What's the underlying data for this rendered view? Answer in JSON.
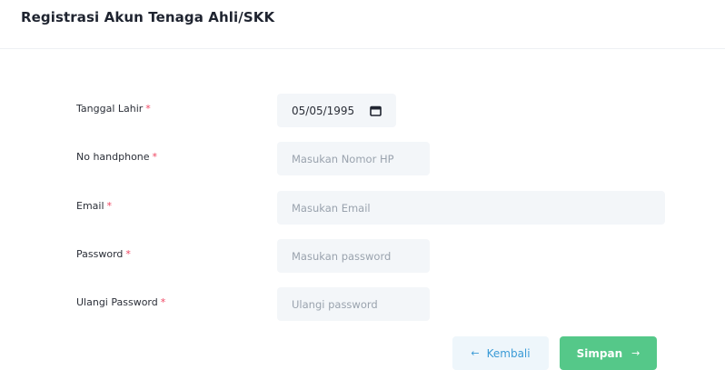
{
  "page": {
    "title": "Registrasi Akun Tenaga Ahli/SKK"
  },
  "form": {
    "required_mark": "*",
    "birth_date": {
      "label": "Tanggal Lahir",
      "value": "05/05/1995"
    },
    "phone": {
      "label": "No handphone",
      "placeholder": "Masukan Nomor HP"
    },
    "email": {
      "label": "Email",
      "placeholder": "Masukan Email"
    },
    "password": {
      "label": "Password",
      "placeholder": "Masukan password"
    },
    "confirm_password": {
      "label": "Ulangi Password",
      "placeholder": "Ulangi password"
    }
  },
  "actions": {
    "back_label": "Kembali",
    "back_icon": "arrow-left-icon",
    "save_label": "Simpan",
    "save_icon": "arrow-right-icon"
  },
  "colors": {
    "required": "#ef4461",
    "field_bg": "#f3f6f9",
    "back_button_bg": "#eef6fb",
    "back_button_text": "#3b9bd6",
    "save_button_bg": "#55c889"
  }
}
